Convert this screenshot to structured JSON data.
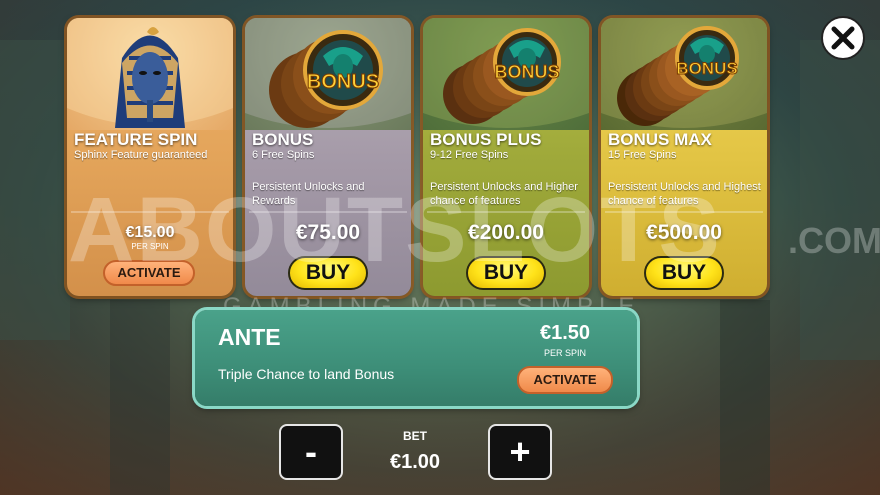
{
  "close": {
    "icon": "close-icon"
  },
  "cards": [
    {
      "title": "FEATURE SPIN",
      "subtitle": "Sphinx Feature guaranteed",
      "description": "",
      "price": "€15.00",
      "per_spin": "PER SPIN",
      "button": "ACTIVATE",
      "image": "sphinx-icon"
    },
    {
      "title": "BONUS",
      "subtitle": "6 Free Spins",
      "description": "Persistent Unlocks and Rewards",
      "price": "€75.00",
      "button": "BUY",
      "image": "bonus-coin-icon"
    },
    {
      "title": "BONUS PLUS",
      "subtitle": "9-12 Free Spins",
      "description": "Persistent Unlocks and Higher chance of features",
      "price": "€200.00",
      "button": "BUY",
      "image": "bonus-coin-icon"
    },
    {
      "title": "BONUS MAX",
      "subtitle": "15 Free Spins",
      "description": "Persistent Unlocks and Highest chance of features",
      "price": "€500.00",
      "button": "BUY",
      "image": "bonus-coin-icon"
    }
  ],
  "coin_text": "BONUS",
  "ante": {
    "title": "ANTE",
    "description": "Triple Chance to land Bonus",
    "price": "€1.50",
    "per_spin": "PER SPIN",
    "button": "ACTIVATE"
  },
  "bet": {
    "label": "BET",
    "value": "€1.00",
    "minus": "-",
    "plus": "+"
  },
  "watermark": {
    "main": "ABOUTSLOTS",
    "suffix": ".COM",
    "tagline": "GAMBLING MADE SIMPLE"
  }
}
